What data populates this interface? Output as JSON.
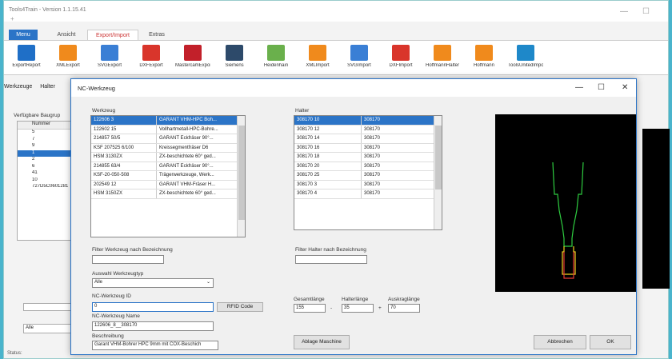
{
  "app": {
    "title": "Tools4Train - Version 1.1.15.41"
  },
  "tabs": {
    "menu": "Menu",
    "ansicht": "Ansicht",
    "export_import": "Export/Import",
    "extras": "Extras"
  },
  "ribbon": [
    {
      "label": "ExportReport",
      "icon": "report-icon",
      "color": "#1f6fc7"
    },
    {
      "label": "XMLExport",
      "icon": "xml-icon",
      "color": "#f08a1c"
    },
    {
      "label": "SVGExport",
      "icon": "svg-icon",
      "color": "#3a7fd5"
    },
    {
      "label": "DXFExport",
      "icon": "dxf-icon",
      "color": "#d9352b"
    },
    {
      "label": "MastercamExport",
      "icon": "mastercam-icon",
      "color": "#c2202a"
    },
    {
      "label": "Siemens",
      "icon": "siemens-icon",
      "color": "#2d4a6a"
    },
    {
      "label": "Heidenhain",
      "icon": "heidenhain-icon",
      "color": "#6ab04c"
    },
    {
      "label": "XMLImport",
      "icon": "xml-icon",
      "color": "#f08a1c"
    },
    {
      "label": "SVGImport",
      "icon": "svg-icon",
      "color": "#3a7fd5"
    },
    {
      "label": "DXFImport",
      "icon": "dxf-icon",
      "color": "#d9352b"
    },
    {
      "label": "HoffmannHalter",
      "icon": "hoffmann-halter-icon",
      "color": "#f08a1c"
    },
    {
      "label": "Hoffmann",
      "icon": "hoffmann-icon",
      "color": "#f08a1c"
    },
    {
      "label": "ToolsUnitedImport",
      "icon": "toolsunited-icon",
      "color": "#1e88c9"
    }
  ],
  "subtabs": [
    "Werkzeuge",
    "Halter"
  ],
  "left": {
    "baugruppe_label": "Verfügbare Baugrup",
    "header": "Nummer",
    "rows": [
      "5",
      "7",
      "9",
      "1",
      "2",
      "6",
      "41",
      "10",
      "727D5C0601281"
    ],
    "selected_index": 3,
    "combo_value": "Alle"
  },
  "status": "Status:",
  "dialog": {
    "title": "NC-Werkzeug",
    "werkzeug_label": "Werkzeug",
    "werkzeug_rows": [
      [
        "122606 3",
        "GARANT VHM-HPC Boh..."
      ],
      [
        "122602 15",
        "Vollhartmetall-HPC-Bohre..."
      ],
      [
        "214857 50/5",
        "GARANT Eckfräser 90°..."
      ],
      [
        "KSF 207525 6/100",
        "Kreissegmentfräser D6"
      ],
      [
        "HSM 3130ZX",
        "ZX-beschichtete 60° ged..."
      ],
      [
        "214855 63/4",
        "GARANT Eckfräser 90°..."
      ],
      [
        "KSF-20-050-508",
        "Trägerwerkzeuge, Werk..."
      ],
      [
        "202549 12",
        "GARANT VHM-Fräser H..."
      ],
      [
        "HSM 3150ZX",
        "ZX-beschichtete 60° ged..."
      ]
    ],
    "halter_label": "Halter",
    "halter_rows": [
      [
        "308170 10",
        "308170"
      ],
      [
        "308170 12",
        "308170"
      ],
      [
        "308170 14",
        "308170"
      ],
      [
        "308170 16",
        "308170"
      ],
      [
        "308170 18",
        "308170"
      ],
      [
        "308170 20",
        "308170"
      ],
      [
        "308170 25",
        "308170"
      ],
      [
        "308170 3",
        "308170"
      ],
      [
        "308170 4",
        "308170"
      ]
    ],
    "filter_werkzeug_label": "Filter Werkzeug nach Bezeichnung",
    "filter_halter_label": "Filter Halter nach Bezeichnung",
    "auswahl_label": "Auswahl Werkzeugtyp",
    "auswahl_value": "Alle",
    "nc_id_label": "NC-Werkzeug ID",
    "nc_id_value": "0",
    "rfid_button": "RFID Code",
    "nc_name_label": "NC-Werkzeug Name",
    "nc_name_value": "122606_8__308170",
    "beschreibung_label": "Beschreibung",
    "beschreibung_value": "Garant VHM-Bohrer HPC 9mm mit COX-Beschich",
    "gesamtlaenge_label": "Gesamtlänge",
    "gesamtlaenge_value": "155",
    "halterlaenge_label": "Halterlänge",
    "halterlaenge_value": "35",
    "auskraglaenge_label": "Auskraglänge",
    "auskraglaenge_value": "70",
    "minus_sign": "-",
    "plus_sign": "+",
    "ablage_button": "Ablage Maschine",
    "abbrechen_button": "Abbrechen",
    "ok_button": "OK"
  }
}
